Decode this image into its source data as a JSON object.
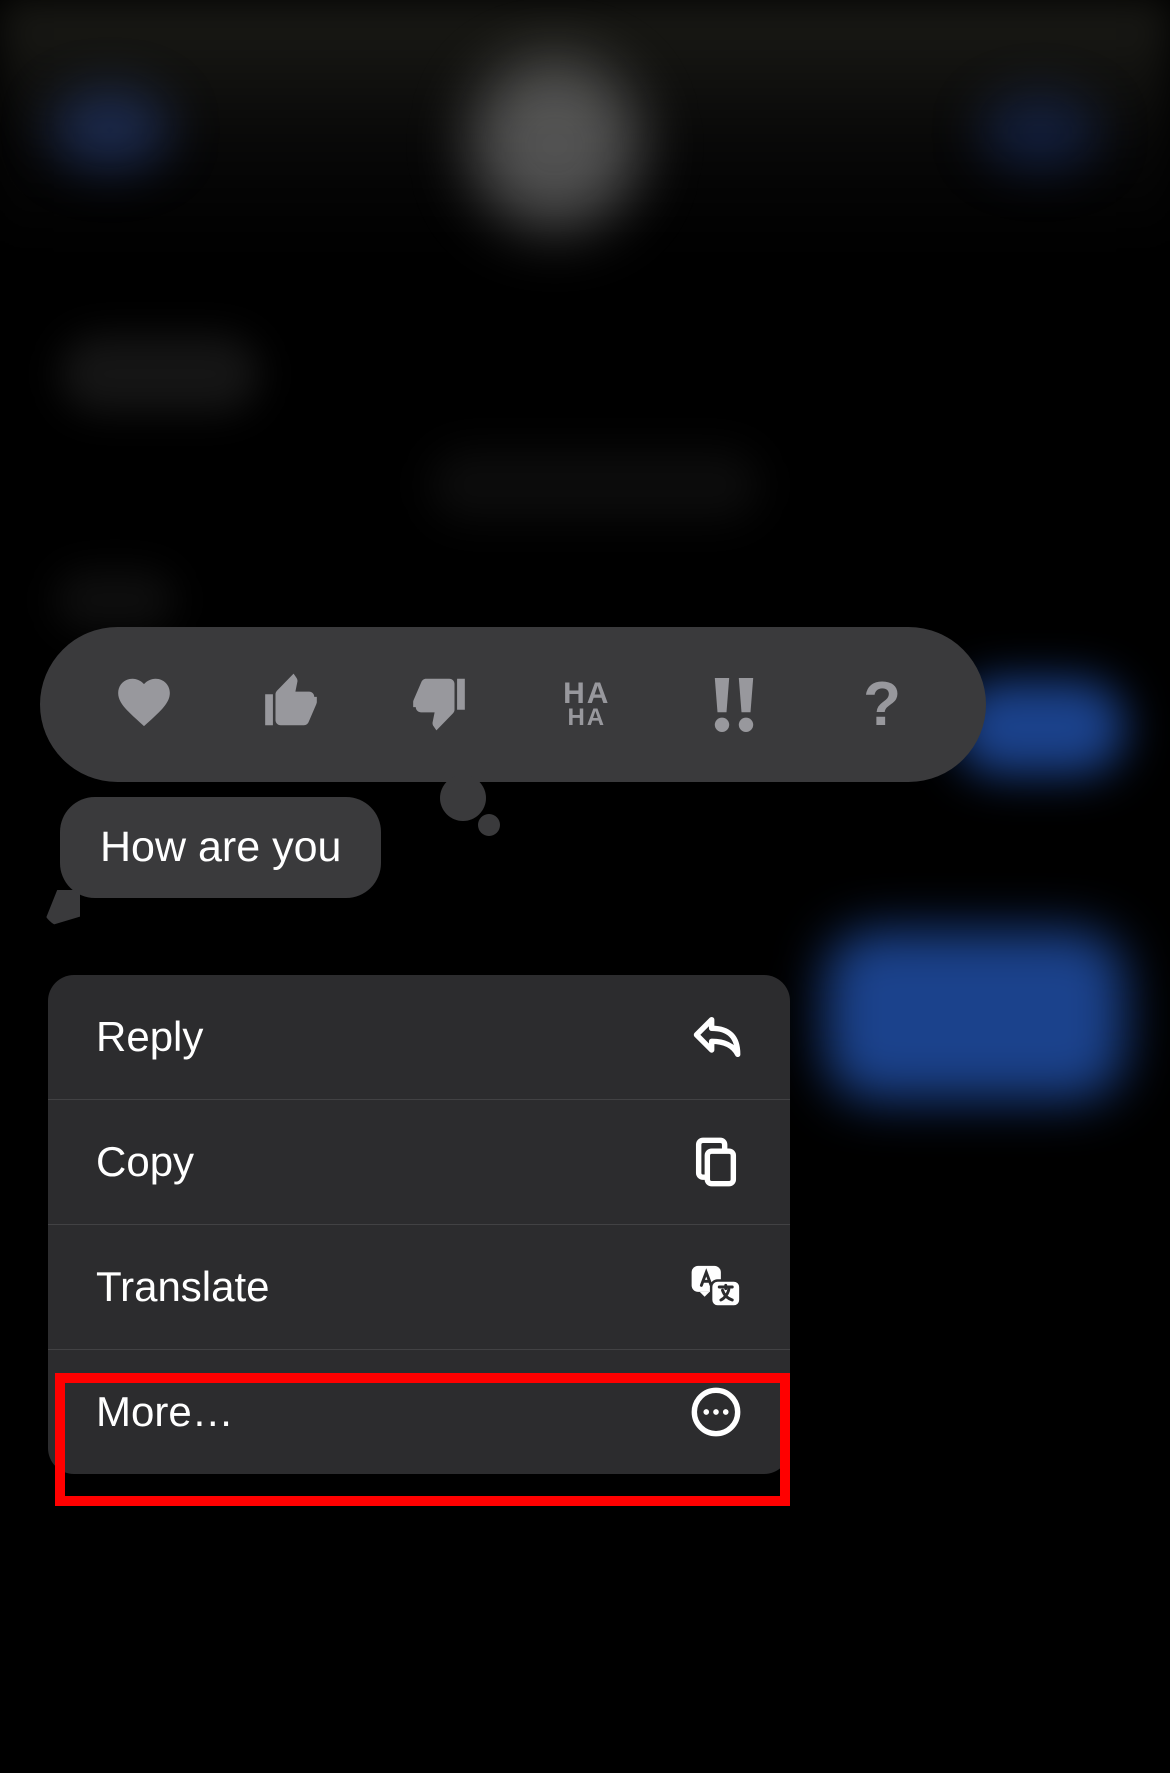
{
  "tapbacks": {
    "heart": "heart",
    "thumbs_up": "thumbs-up",
    "thumbs_down": "thumbs-down",
    "haha_top": "HA",
    "haha_bottom": "HA",
    "exclaim": "!!",
    "question": "?"
  },
  "message": {
    "text": "How are you"
  },
  "menu": {
    "reply": "Reply",
    "copy": "Copy",
    "translate": "Translate",
    "more": "More…"
  },
  "highlight": {
    "target": "more-menu-item"
  }
}
